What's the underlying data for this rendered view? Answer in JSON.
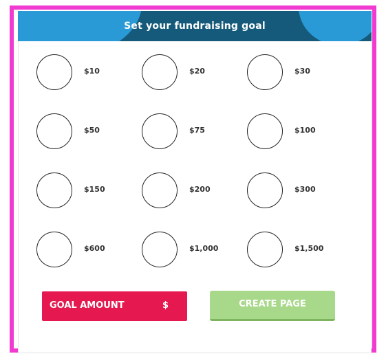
{
  "header": {
    "title": "Set your fundraising goal"
  },
  "amounts": [
    "$10",
    "$20",
    "$30",
    "$50",
    "$75",
    "$100",
    "$150",
    "$200",
    "$300",
    "$600",
    "$1,000",
    "$1,500"
  ],
  "goal_input": {
    "label": "GOAL AMOUNT",
    "currency": "$"
  },
  "create_button": {
    "label": "CREATE PAGE"
  },
  "colors": {
    "header": "#155a7a",
    "header_accent": "#2a9ad6",
    "goal_button": "#e5194f",
    "create_button": "#a8d889",
    "frame": "#f03ad0"
  }
}
